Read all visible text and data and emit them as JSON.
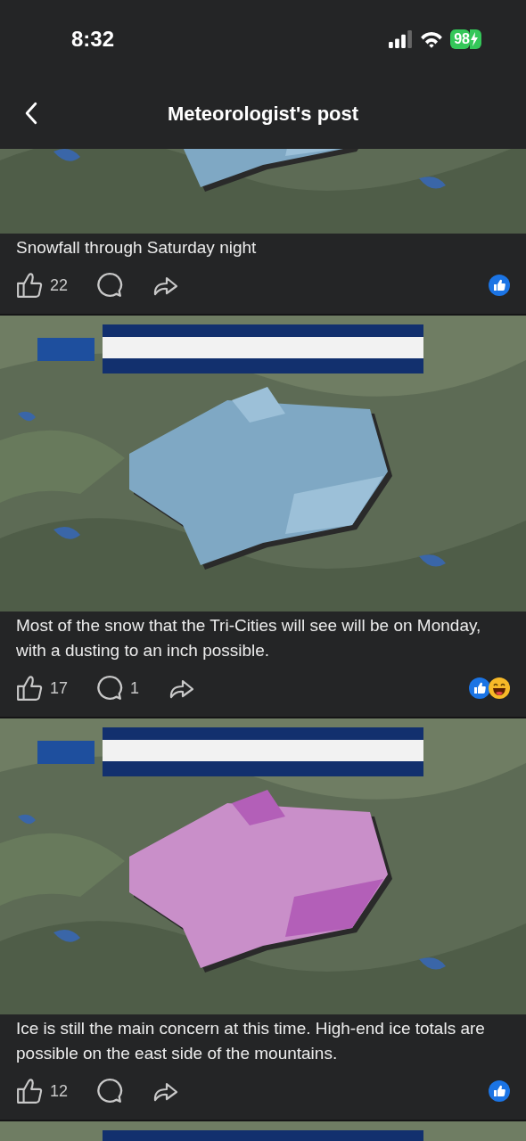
{
  "status_bar": {
    "time": "8:32",
    "battery": "98"
  },
  "header": {
    "title": "Meteorologist's post"
  },
  "posts": [
    {
      "image": {
        "kind": "picture"
      },
      "caption": "Snowfall through Saturday night",
      "likes": "22",
      "reactions": [
        {
          "kind": "like"
        }
      ]
    },
    {
      "image": {
        "kind": "picture"
      },
      "caption": "Most of the snow that the Tri-Cities will see will be on Monday, with a dusting to an inch possible.",
      "likes": "17",
      "comments": "1",
      "reactions": [
        {
          "kind": "like"
        },
        {
          "kind": "haha"
        }
      ]
    },
    {
      "image": {
        "kind": "picture"
      },
      "caption": "Ice is still the main concern at this time. High-end ice totals are possible on the east side of the mountains.",
      "likes": "12",
      "reactions": [
        {
          "kind": "like"
        }
      ]
    },
    {
      "image": {
        "kind": "picture"
      }
    }
  ]
}
